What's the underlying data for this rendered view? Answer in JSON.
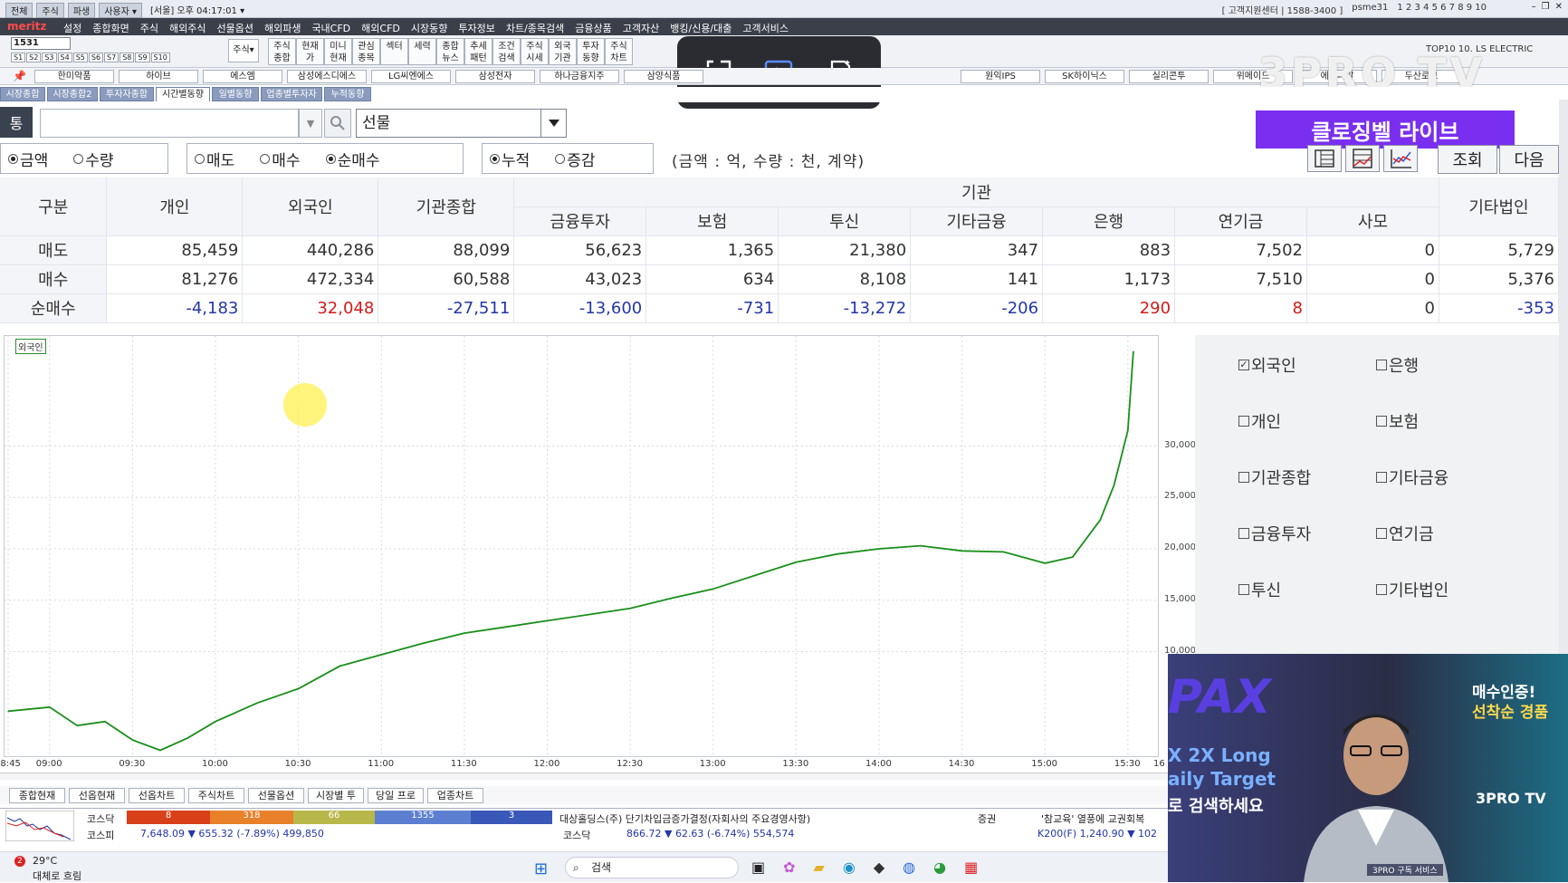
{
  "sysbar": {
    "tabs": [
      "전체",
      "주식",
      "파생",
      "사용자 ▾"
    ],
    "clock": "[서울] 오후 04:17:01 ▾",
    "center": "[ 고객지원센터 | 1588-3400 ]",
    "user": "psme31",
    "nums": "1 2 3 4 5 6 7 8 9 10"
  },
  "menubar": {
    "logo": "meritz",
    "items": [
      "설정",
      "종합화면",
      "주식",
      "해외주식",
      "선물옵션",
      "해외파생",
      "국내CFD",
      "해외CFD",
      "시장동향",
      "투자정보",
      "차트/종목검색",
      "금융상품",
      "고객자산",
      "뱅킹/신용/대출",
      "고객서비스"
    ]
  },
  "toolbar": {
    "code": "1531",
    "slots": [
      "S1",
      "S2",
      "S3",
      "S4",
      "S5",
      "S6",
      "S7",
      "S8",
      "S9",
      "S10"
    ],
    "stock_dd": "주식▾",
    "buttons": [
      "주식\n종합",
      "현재\n가",
      "미니\n현재",
      "관심\n종목",
      "섹터",
      "세력",
      "종합\n뉴스",
      "추세\n패턴",
      "조건\n검색",
      "주식\n시세",
      "외국\n기관",
      "투자\n동향",
      "주식\n차트"
    ],
    "right_text": "TOP10  10. LS ELECTRIC"
  },
  "favbar": [
    "한미약품",
    "하이브",
    "에스엠",
    "삼성에스디에스",
    "LG씨엔에스",
    "삼성전자",
    "하나금융지주",
    "삼양식품",
    "",
    "",
    "",
    "원익IPS",
    "SK하이닉스",
    "실리콘투",
    "위메이드",
    "에이피알",
    "두산로보"
  ],
  "watermark": "3PRO TV",
  "window_tabs": [
    "시장종합",
    "시장종합2",
    "투자자종합",
    "시간별동향",
    "일별동향",
    "업종별투자자",
    "누적동향"
  ],
  "search": {
    "side_label": "통",
    "select_value": "선물"
  },
  "banner": "클로징벨 라이브",
  "options": {
    "group1": [
      {
        "label": "금액",
        "on": true
      },
      {
        "label": "수량",
        "on": false
      }
    ],
    "group2": [
      {
        "label": "매도",
        "on": false
      },
      {
        "label": "매수",
        "on": false
      },
      {
        "label": "순매수",
        "on": true
      }
    ],
    "group3": [
      {
        "label": "누적",
        "on": true
      },
      {
        "label": "증감",
        "on": false
      }
    ],
    "unit_note": "(금액 : 억, 수량 : 천, 계약)",
    "query_btn": "조회",
    "next_btn": "다음"
  },
  "table": {
    "group_header": "기관",
    "headers_top": [
      "구분",
      "개인",
      "외국인",
      "기관종합",
      "기타법인"
    ],
    "headers_sub": [
      "금융투자",
      "보험",
      "투신",
      "기타금융",
      "은행",
      "연기금",
      "사모"
    ],
    "rows": [
      {
        "label": "매도",
        "cells": [
          "85,459",
          "440,286",
          "88,099",
          "56,623",
          "1,365",
          "21,380",
          "347",
          "883",
          "7,502",
          "0",
          "5,729"
        ]
      },
      {
        "label": "매수",
        "cells": [
          "81,276",
          "472,334",
          "60,588",
          "43,023",
          "634",
          "8,108",
          "141",
          "1,173",
          "7,510",
          "0",
          "5,376"
        ]
      },
      {
        "label": "순매수",
        "cells": [
          "-4,183",
          "32,048",
          "-27,511",
          "-13,600",
          "-731",
          "-13,272",
          "-206",
          "290",
          "8",
          "0",
          "-353"
        ]
      }
    ]
  },
  "chart_data": {
    "type": "line",
    "series": [
      {
        "name": "외국인",
        "color": "#1a8f1a",
        "x": [
          "08:45",
          "09:00",
          "09:10",
          "09:20",
          "09:30",
          "09:40",
          "09:50",
          "10:00",
          "10:15",
          "10:30",
          "10:45",
          "11:00",
          "11:15",
          "11:30",
          "11:45",
          "12:00",
          "12:15",
          "12:30",
          "12:45",
          "13:00",
          "13:15",
          "13:30",
          "13:45",
          "14:00",
          "14:15",
          "14:30",
          "14:45",
          "15:00",
          "15:10",
          "15:20",
          "15:25",
          "15:30",
          "15:32"
        ],
        "values": [
          4200,
          4600,
          2800,
          3200,
          1400,
          400,
          1600,
          3200,
          5000,
          6400,
          8600,
          9700,
          10800,
          11800,
          12400,
          13000,
          13600,
          14200,
          15200,
          16100,
          17400,
          18700,
          19500,
          20000,
          20300,
          19800,
          19700,
          18600,
          19200,
          22800,
          26200,
          31500,
          39200
        ]
      }
    ],
    "xticks": [
      "08:45",
      "09:00",
      "09:30",
      "10:00",
      "10:30",
      "11:00",
      "11:30",
      "12:00",
      "12:30",
      "13:00",
      "13:30",
      "14:00",
      "14:30",
      "15:00",
      "15:30",
      "16"
    ],
    "yticks": [
      "30,000",
      "25,000",
      "20,000",
      "15,000",
      "10,000"
    ],
    "ylim": [
      0,
      40000
    ]
  },
  "legend": [
    {
      "label": "외국인",
      "checked": true
    },
    {
      "label": "은행",
      "checked": false
    },
    {
      "label": "개인",
      "checked": false
    },
    {
      "label": "보험",
      "checked": false
    },
    {
      "label": "기관종합",
      "checked": false
    },
    {
      "label": "기타금융",
      "checked": false
    },
    {
      "label": "금융투자",
      "checked": false
    },
    {
      "label": "연기금",
      "checked": false
    },
    {
      "label": "투신",
      "checked": false
    },
    {
      "label": "기타법인",
      "checked": false
    }
  ],
  "bottom_tabs": [
    "종합현재",
    "선옵현재",
    "선옵차트",
    "주식차트",
    "선물옵션",
    "시장별 투",
    "당일 프로",
    "업종차트"
  ],
  "ticker": {
    "kosdaq_label": "코스닥",
    "kospi_label": "코스피",
    "bar": [
      "8",
      "318",
      "66",
      "1355",
      "3"
    ],
    "kospi_val": "7,648.09 ▼ 655.32 (-7.89%)   499,850",
    "news": "대상홀딩스(주) 단기차입금증가결정(자회사의 주요경영사항)",
    "news_tag": "증권",
    "kosdaq_val": "866.72 ▼ 62.63 (-6.74%)   554,574",
    "ref": "'참교육' 열풍에 교권회복",
    "k200": "K200(F)   1,240.90 ▼ 102"
  },
  "taskbar": {
    "temp": "29°C",
    "weather": "대체로 흐림",
    "badge": "2",
    "search": "검색"
  },
  "webcam": {
    "brand": "PAX",
    "line1": "X 2X Long",
    "line2": "aily Target",
    "line3": "로 검색하세요",
    "promo1": "매수인증!",
    "promo2": "선착순 경품",
    "logo": "3PRO TV",
    "caption": "3PRO 구독 서비스"
  }
}
